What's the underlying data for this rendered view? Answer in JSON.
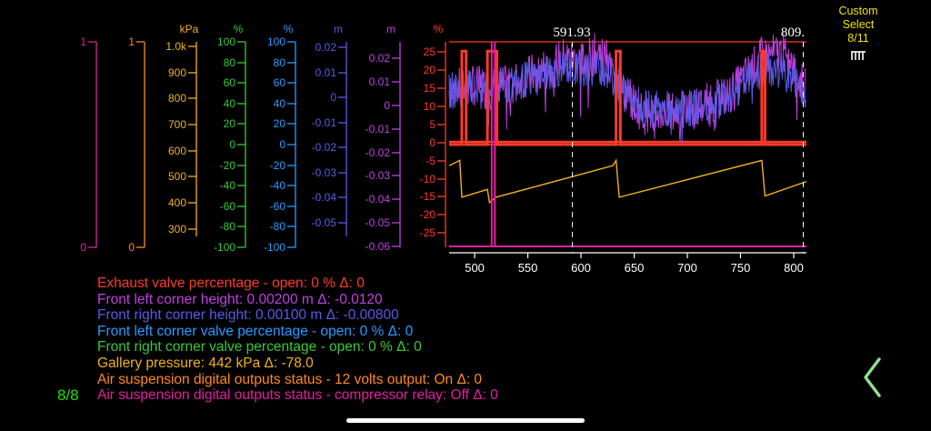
{
  "colors": {
    "exhaust": "#ff3a2a",
    "front_left_height": "#c040e0",
    "front_right_height": "#5a5ae8",
    "front_left_valve": "#2a9cff",
    "front_right_valve": "#36c936",
    "gallery_pressure": "#f0b020",
    "output_12v": "#ff8a1e",
    "compressor_relay": "#e020a0",
    "custom_select": "#f2e200",
    "page_indicator": "#22e000",
    "chevron": "#90e090"
  },
  "custom_select": {
    "line1": "Custom",
    "line2": "Select",
    "line3": "8/11"
  },
  "cursor_labels": {
    "left": "591.93",
    "right": "809."
  },
  "page_indicator": "8/8",
  "chevron_icon": "chevron-left-icon",
  "axes": [
    {
      "id": "compressor",
      "unit": "",
      "ticks": [
        "1",
        "0"
      ]
    },
    {
      "id": "output12v",
      "unit": "",
      "ticks": [
        "1",
        "0"
      ]
    },
    {
      "id": "pressure",
      "unit": "kPa",
      "ticks": [
        "1.0k",
        "900",
        "800",
        "700",
        "600",
        "500",
        "400",
        "300"
      ]
    },
    {
      "id": "fr_valve",
      "unit": "%",
      "ticks": [
        "100",
        "80",
        "60",
        "40",
        "20",
        "0",
        "-20",
        "-40",
        "-60",
        "-80",
        "-100"
      ]
    },
    {
      "id": "fl_valve",
      "unit": "%",
      "ticks": [
        "100",
        "80",
        "60",
        "40",
        "20",
        "0",
        "-20",
        "-40",
        "-60",
        "-80",
        "-100"
      ]
    },
    {
      "id": "fr_height",
      "unit": "m",
      "ticks": [
        "0.02",
        "0.01",
        "0",
        "-0.01",
        "-0.02",
        "-0.03",
        "-0.04",
        "-0.05"
      ]
    },
    {
      "id": "fl_height",
      "unit": "m",
      "ticks": [
        "0.02",
        "0.01",
        "0",
        "-0.01",
        "-0.02",
        "-0.03",
        "-0.04",
        "-0.05",
        "-0.06"
      ]
    },
    {
      "id": "exhaust",
      "unit": "%",
      "ticks": [
        "25",
        "20",
        "15",
        "10",
        "5",
        "0",
        "-5",
        "-10",
        "-15",
        "-20",
        "-25"
      ]
    }
  ],
  "legend": [
    {
      "id": "exhaust",
      "text": "Exhaust valve percentage - open: 0 % Δ: 0"
    },
    {
      "id": "front_left_height",
      "text": "Front left corner height: 0.00200 m Δ: -0.0120"
    },
    {
      "id": "front_right_height",
      "text": "Front right corner height: 0.00100 m Δ: -0.00800"
    },
    {
      "id": "front_left_valve",
      "text": "Front left corner valve percentage - open: 0 % Δ: 0"
    },
    {
      "id": "front_right_valve",
      "text": "Front right corner valve percentage - open: 0 % Δ: 0"
    },
    {
      "id": "gallery_pressure",
      "text": "Gallery pressure: 442 kPa Δ: -78.0"
    },
    {
      "id": "output_12v",
      "text": "Air suspension digital outputs status  -  12 volts output: On Δ: 0"
    },
    {
      "id": "compressor_relay",
      "text": "Air suspension digital outputs status - compressor relay: Off Δ: 0"
    }
  ],
  "chart_data": {
    "type": "line",
    "x_ticks": [
      "500",
      "550",
      "600",
      "650",
      "700",
      "750",
      "800"
    ],
    "xlim": [
      476,
      812
    ],
    "cursors": [
      591.93,
      809
    ],
    "series": [
      {
        "name": "Exhaust valve percentage - open",
        "unit": "%",
        "ylim": [
          -27.5,
          27.5
        ],
        "steps": [
          [
            476,
            0
          ],
          [
            488,
            25
          ],
          [
            492,
            0
          ],
          [
            512,
            25
          ],
          [
            521,
            0
          ],
          [
            633,
            25
          ],
          [
            637,
            0
          ],
          [
            770,
            25
          ],
          [
            773,
            0
          ]
        ]
      },
      {
        "name": "Front left corner height",
        "unit": "m",
        "ylim": [
          -0.0625,
          0.0245
        ],
        "points": [
          [
            476,
            0.004
          ],
          [
            500,
            0.006
          ],
          [
            520,
            0.004
          ],
          [
            560,
            0.012
          ],
          [
            585,
            0.018
          ],
          [
            600,
            0.016
          ],
          [
            620,
            0.021
          ],
          [
            640,
            0.003
          ],
          [
            660,
            -0.006
          ],
          [
            700,
            -0.005
          ],
          [
            740,
            0.002
          ],
          [
            770,
            0.018
          ],
          [
            790,
            0.02
          ],
          [
            800,
            0.012
          ],
          [
            812,
            0.004
          ]
        ]
      },
      {
        "name": "Front right corner height",
        "unit": "m",
        "ylim": [
          -0.0625,
          0.0245
        ],
        "points": [
          [
            476,
            0.004
          ],
          [
            500,
            0.005
          ],
          [
            520,
            0.005
          ],
          [
            560,
            0.01
          ],
          [
            585,
            0.014
          ],
          [
            600,
            0.012
          ],
          [
            620,
            0.014
          ],
          [
            640,
            0.004
          ],
          [
            660,
            -0.004
          ],
          [
            700,
            -0.004
          ],
          [
            740,
            0.002
          ],
          [
            770,
            0.013
          ],
          [
            790,
            0.012
          ],
          [
            800,
            0.008
          ],
          [
            812,
            0.004
          ]
        ]
      },
      {
        "name": "Gallery pressure",
        "unit": "kPa",
        "ylim": [
          250,
          1030
        ],
        "points": [
          [
            476,
            560
          ],
          [
            486,
            580
          ],
          [
            488,
            440
          ],
          [
            512,
            470
          ],
          [
            514,
            420
          ],
          [
            520,
            440
          ],
          [
            630,
            560
          ],
          [
            633,
            580
          ],
          [
            636,
            440
          ],
          [
            770,
            580
          ],
          [
            773,
            445
          ],
          [
            812,
            500
          ]
        ]
      }
    ],
    "axis_text_note": "x axis unlabeled"
  }
}
